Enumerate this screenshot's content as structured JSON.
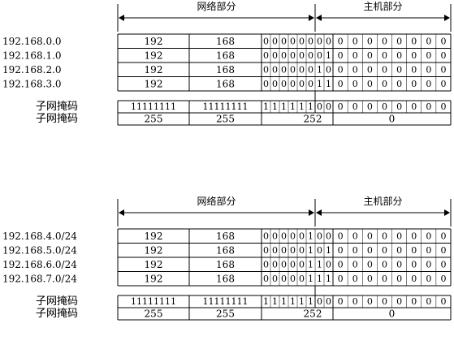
{
  "sections": [
    {
      "network_header": "网络部分",
      "host_header": "主机部分",
      "rows": [
        {
          "label": "192.168.0.0",
          "o1": "192",
          "o2": "168",
          "bits3": "00000000",
          "o4bits": "00000000"
        },
        {
          "label": "192.168.1.0",
          "o1": "192",
          "o2": "168",
          "bits3": "00000001",
          "o4bits": "00000000"
        },
        {
          "label": "192.168.2.0",
          "o1": "192",
          "o2": "168",
          "bits3": "00000010",
          "o4bits": "00000000"
        },
        {
          "label": "192.168.3.0",
          "o1": "192",
          "o2": "168",
          "bits3": "00000011",
          "o4bits": "00000000"
        }
      ],
      "mask_binary": {
        "label": "子网掩码",
        "o1": "11111111",
        "o2": "11111111",
        "bits3": "11111100",
        "o4bits": "00000000"
      },
      "mask_decimal": {
        "label": "子网掩码",
        "o1": "255",
        "o2": "255",
        "o3": "252",
        "o4": "0"
      }
    },
    {
      "network_header": "网络部分",
      "host_header": "主机部分",
      "rows": [
        {
          "label": "192.168.4.0/24",
          "o1": "192",
          "o2": "168",
          "bits3": "00000100",
          "o4bits": "00000000"
        },
        {
          "label": "192.168.5.0/24",
          "o1": "192",
          "o2": "168",
          "bits3": "00000101",
          "o4bits": "00000000"
        },
        {
          "label": "192.168.6.0/24",
          "o1": "192",
          "o2": "168",
          "bits3": "00000110",
          "o4bits": "00000000"
        },
        {
          "label": "192.168.7.0/24",
          "o1": "192",
          "o2": "168",
          "bits3": "00000111",
          "o4bits": "00000000"
        }
      ],
      "mask_binary": {
        "label": "子网掩码",
        "o1": "11111111",
        "o2": "11111111",
        "bits3": "11111100",
        "o4bits": "00000000"
      },
      "mask_decimal": {
        "label": "子网掩码",
        "o1": "255",
        "o2": "255",
        "o3": "252",
        "o4": "0"
      }
    }
  ]
}
